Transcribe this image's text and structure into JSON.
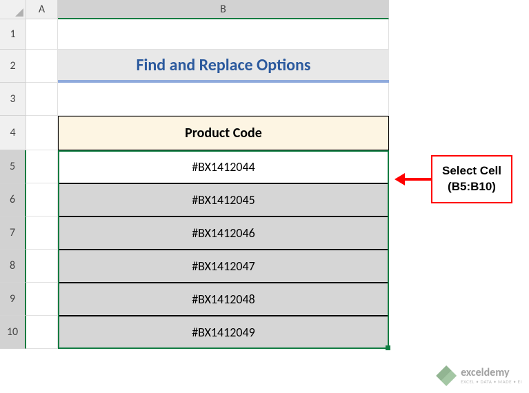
{
  "columns": {
    "a": "A",
    "b": "B"
  },
  "rows": {
    "r1": "1",
    "r2": "2",
    "r3": "3",
    "r4": "4",
    "r5": "5",
    "r6": "6",
    "r7": "7",
    "r8": "8",
    "r9": "9",
    "r10": "10"
  },
  "title": "Find and Replace Options",
  "header": "Product Code",
  "data": {
    "r5": "#BX1412044",
    "r6": "#BX1412045",
    "r7": "#BX1412046",
    "r8": "#BX1412047",
    "r9": "#BX1412048",
    "r10": "#BX1412049"
  },
  "callout": {
    "line1": "Select Cell",
    "line2": "(B5:B10)"
  },
  "watermark": {
    "brand": "exceldemy",
    "tagline": "EXCEL • DATA • MADE • EI"
  },
  "chart_data": {
    "type": "table",
    "title": "Find and Replace Options",
    "columns": [
      "Product Code"
    ],
    "rows": [
      [
        "#BX1412044"
      ],
      [
        "#BX1412045"
      ],
      [
        "#BX1412046"
      ],
      [
        "#BX1412047"
      ],
      [
        "#BX1412048"
      ],
      [
        "#BX1412049"
      ]
    ],
    "selection": "B5:B10"
  }
}
